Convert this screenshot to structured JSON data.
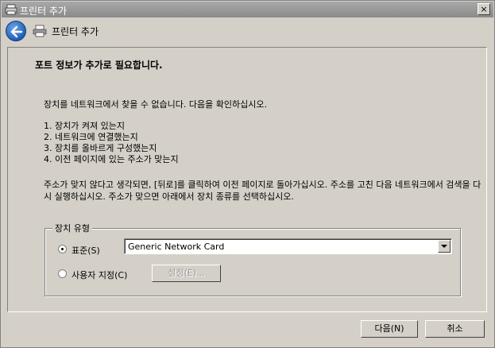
{
  "window": {
    "title": "프린터 추가",
    "close_label": "×"
  },
  "nav": {
    "title": "프린터 추가"
  },
  "page": {
    "heading": "포트 정보가 추가로 필요합니다.",
    "intro": "장치를 네트워크에서 찾을 수 없습니다. 다음을 확인하십시오.",
    "checklist": [
      "1.  장치가 켜져 있는지",
      "2.  네트워크에 연결했는지",
      "3.  장치를 올바르게 구성했는지",
      "4.  이전 페이지에 있는 주소가 맞는지"
    ],
    "note": "주소가 맞지 않다고 생각되면, [뒤로]를 클릭하여 이전 페이지로 돌아가십시오. 주소를 고친 다음 네트워크에서 검색을 다시 실행하십시오. 주소가 맞으면 아래에서 장치 종류를 선택하십시오."
  },
  "device_type": {
    "label": "장치 유형",
    "standard_label": "표준(S)",
    "standard_selected": true,
    "standard_value": "Generic Network Card",
    "custom_label": "사용자 지정(C)",
    "settings_label": "설정(E)..."
  },
  "footer": {
    "next_label": "다음(N)",
    "cancel_label": "취소"
  }
}
